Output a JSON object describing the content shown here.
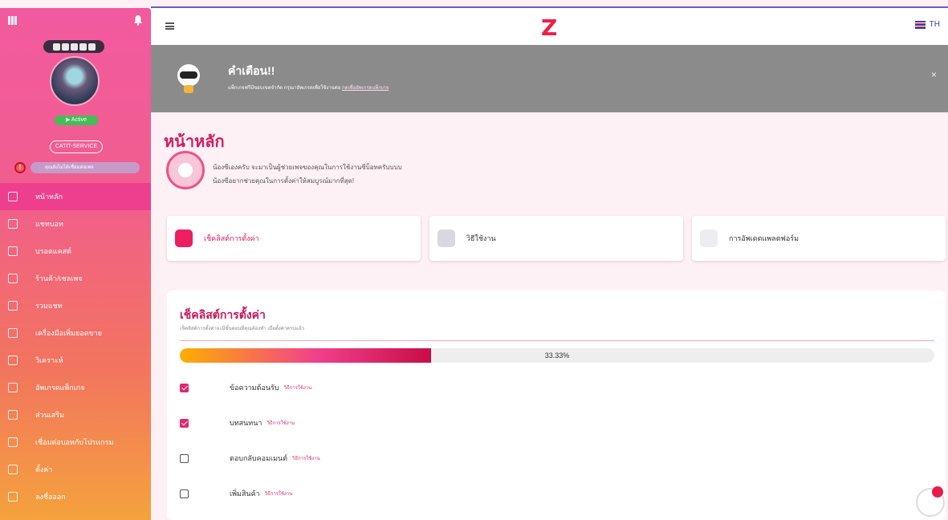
{
  "colors": {
    "brand": "#ec1f46",
    "accent": "#d41b5e",
    "sidebar_gradient_top": "#f25aa0",
    "sidebar_gradient_bottom": "#f4a23c"
  },
  "sidebar": {
    "status_label": "▶ Active",
    "service_label": "CATIT-SERVICE",
    "warning_text": "คุณยังไม่ได้เชื่อมต่อเพจ",
    "items": [
      {
        "label": "หน้าหลัก",
        "icon": "home-icon",
        "active": true
      },
      {
        "label": "แชทบอท",
        "icon": "chat-icon",
        "active": false
      },
      {
        "label": "บรอดแคสต์",
        "icon": "megaphone-icon",
        "active": false
      },
      {
        "label": "ร้านค้า/เซลเพจ",
        "icon": "store-icon",
        "active": false
      },
      {
        "label": "รวมแชท",
        "icon": "inbox-icon",
        "active": false
      },
      {
        "label": "เครื่องมือเพิ่มยอดขาย",
        "icon": "chart-icon",
        "active": false
      },
      {
        "label": "วิเคราะห์",
        "icon": "analytics-icon",
        "active": false
      },
      {
        "label": "อัพเกรดแพ็กเกจ",
        "icon": "crown-icon",
        "active": false
      },
      {
        "label": "ส่วนเสริม",
        "icon": "plugin-icon",
        "active": false
      },
      {
        "label": "เชื่อมต่อบอทกับโปรแกรม",
        "icon": "link-icon",
        "active": false
      },
      {
        "label": "ตั้งค่า",
        "icon": "settings-icon",
        "active": false
      },
      {
        "label": "ลงชื่อออก",
        "icon": "logout-icon",
        "active": false
      }
    ]
  },
  "topbar": {
    "logo": "Z",
    "language": "TH"
  },
  "banner": {
    "title": "คำเตือน!!",
    "text": "แพ็กเกจฟรีมีขอบเขตจำกัด กรุณาอัพเกรดเพื่อใช้งานต่อ ",
    "link": "กดเพื่ออัพเกรดแพ็กเกจ",
    "close": "×"
  },
  "main": {
    "title": "หน้าหลัก",
    "intro_line1": "น้องซีเองครับ จะมาเป็นผู้ช่วยเพจของคุณในการใช้งานซีบ็อทครับบบบ",
    "intro_line2": "น้องซีอยากช่วยคุณในการตั้งค่าให้สมบูรณ์มากที่สุด!",
    "cards": [
      {
        "label": "เช็คลิสต์การตั้งค่า",
        "icon": "clipboard-icon"
      },
      {
        "label": "วิธีใช้งาน",
        "icon": "book-icon"
      },
      {
        "label": "การอัพเดตแพลตฟอร์ม",
        "icon": "wrench-icon"
      }
    ]
  },
  "checklist": {
    "title": "เช็คลิสต์การตั้งค่า",
    "subtitle": "เช็คลิสต์การตั้งค่าจะมีขั้นตอนที่คุณต้องทำ เมื่อตั้งค่าครบแล้ว",
    "progress_label": "33.33%",
    "progress_fraction": 0.3333,
    "howto_label": "วิธีการใช้งาน",
    "items": [
      {
        "label": "ข้อความต้อนรับ",
        "checked": true
      },
      {
        "label": "บทสนทนา",
        "checked": true
      },
      {
        "label": "ตอบกลับคอมเมนต์",
        "checked": false
      },
      {
        "label": "เพิ่มสินค้า",
        "checked": false
      }
    ]
  }
}
